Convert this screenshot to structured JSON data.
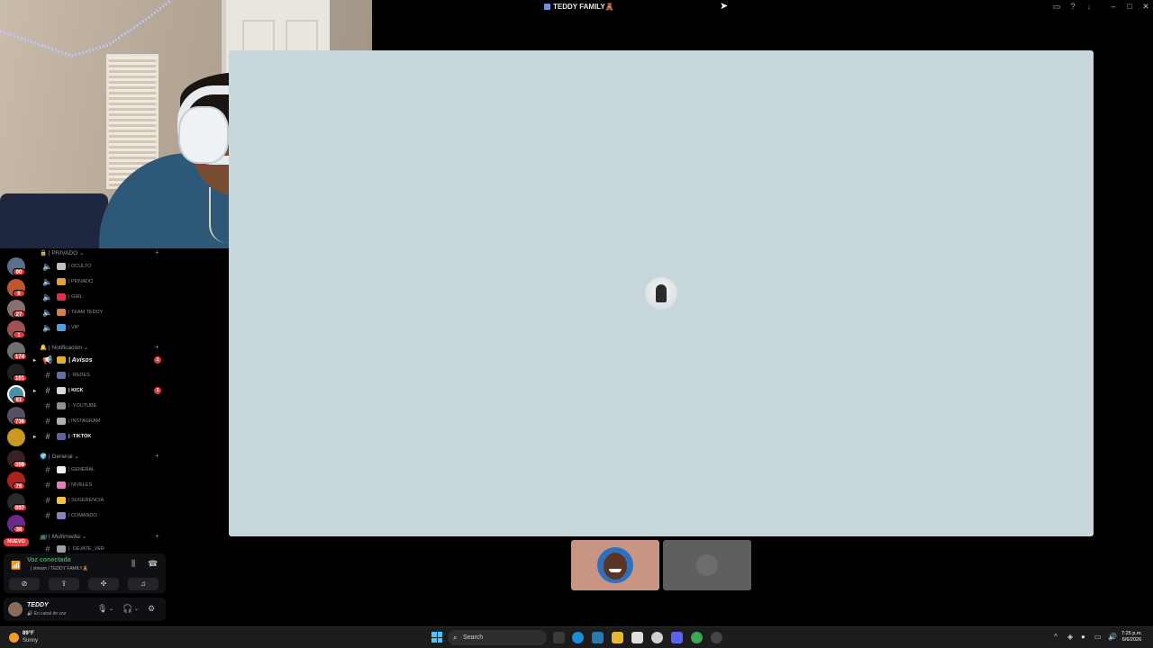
{
  "window": {
    "title": "TEDDY FAMILY🧸"
  },
  "channels": {
    "categories": [
      {
        "label": "🔒 | PRIVADO ⌄"
      },
      {
        "label": "🔔 | Notificacion ⌄"
      },
      {
        "label": "🌍 | General ⌄"
      },
      {
        "label": "📺 | Multimedia ⌄"
      }
    ],
    "voice_items": [
      {
        "label": "| OCULTO"
      },
      {
        "label": "| PRIVADO"
      },
      {
        "label": "| GIRL"
      },
      {
        "label": "| TEAM TEDDY"
      },
      {
        "label": "| VIP"
      }
    ],
    "notif_items": [
      {
        "label": "| Avisos",
        "badge": "1"
      },
      {
        "label": "| ·REDES"
      },
      {
        "label": "| KICK",
        "badge": "1"
      },
      {
        "label": "| ·YOUTUBE"
      },
      {
        "label": "| INSTAGRAM"
      },
      {
        "label": "| ·TIKTOK"
      }
    ],
    "general_items": [
      {
        "label": "| GENERAL"
      },
      {
        "label": "| NIVELES"
      },
      {
        "label": "| SUGERENCIA"
      },
      {
        "label": "| COMANDO"
      }
    ],
    "multimedia_items": [
      {
        "label": "| ·DEJATE_VER"
      }
    ]
  },
  "servers": {
    "badges": [
      "90",
      "6",
      "27",
      "1",
      "174",
      "101",
      "61",
      "736",
      "309",
      "76",
      "897",
      "38"
    ],
    "new_label": "NUEVO"
  },
  "voice": {
    "status": "Voz conectada",
    "channel": "| stream / TEDDY FAMILY🧸"
  },
  "user": {
    "name": "TEDDY",
    "status": "🔊 En canal de voz"
  },
  "taskbar": {
    "temperature": "89°F",
    "weather": "Sunny",
    "search_placeholder": "Search",
    "time": "7:25 p.m.",
    "date": "6/6/2026"
  },
  "colors": {
    "stream_bg": "#c6d6da",
    "voice_green": "#3ba55c",
    "badge_red": "#e0393e",
    "tile1": "#c89484",
    "tile2": "#5f5f5f"
  }
}
